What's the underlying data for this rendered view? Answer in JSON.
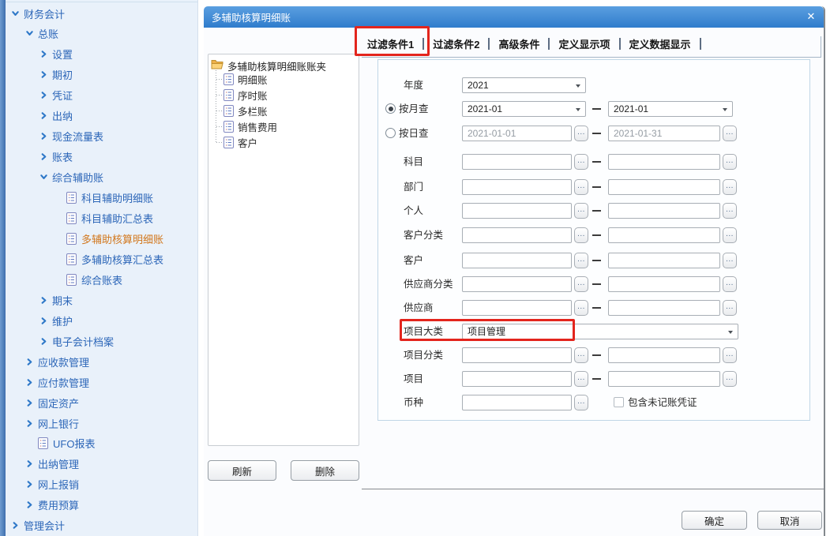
{
  "colors": {
    "titlebar_top": "#5b9fe0",
    "titlebar_bottom": "#2f7ccc",
    "sidebar_text": "#2c66b8",
    "sidebar_selected": "#d2771c",
    "annotation_red": "#e3251d",
    "chevron_blue": "#2e78c8",
    "folder_gold": "#f6c25a"
  },
  "icons": {
    "close": "✕",
    "browse_dots": "...",
    "chevron_expanded": "chevron-down",
    "chevron_collapsed": "chevron-right",
    "report": "report-document",
    "folder": "folder-open",
    "document": "document-page"
  },
  "sidebar": {
    "items": [
      {
        "label": "财务会计",
        "level": 0,
        "icon": "expanded"
      },
      {
        "label": "总账",
        "level": 1,
        "icon": "expanded"
      },
      {
        "label": "设置",
        "level": 2,
        "icon": "collapsed"
      },
      {
        "label": "期初",
        "level": 2,
        "icon": "collapsed"
      },
      {
        "label": "凭证",
        "level": 2,
        "icon": "collapsed"
      },
      {
        "label": "出纳",
        "level": 2,
        "icon": "collapsed"
      },
      {
        "label": "现金流量表",
        "level": 2,
        "icon": "collapsed"
      },
      {
        "label": "账表",
        "level": 2,
        "icon": "collapsed"
      },
      {
        "label": "综合辅助账",
        "level": 2,
        "icon": "expanded"
      },
      {
        "label": "科目辅助明细账",
        "level": 3,
        "icon": "doc"
      },
      {
        "label": "科目辅助汇总表",
        "level": 3,
        "icon": "doc"
      },
      {
        "label": "多辅助核算明细账",
        "level": 3,
        "icon": "doc",
        "selected": true
      },
      {
        "label": "多辅助核算汇总表",
        "level": 3,
        "icon": "doc"
      },
      {
        "label": "综合账表",
        "level": 3,
        "icon": "doc"
      },
      {
        "label": "期末",
        "level": 2,
        "icon": "collapsed"
      },
      {
        "label": "维护",
        "level": 2,
        "icon": "collapsed"
      },
      {
        "label": "电子会计档案",
        "level": 2,
        "icon": "collapsed"
      },
      {
        "label": "应收款管理",
        "level": 1,
        "icon": "collapsed"
      },
      {
        "label": "应付款管理",
        "level": 1,
        "icon": "collapsed"
      },
      {
        "label": "固定资产",
        "level": 1,
        "icon": "collapsed"
      },
      {
        "label": "网上银行",
        "level": 1,
        "icon": "collapsed"
      },
      {
        "label": "UFO报表",
        "level": 1,
        "icon": "doc"
      },
      {
        "label": "出纳管理",
        "level": 1,
        "icon": "collapsed"
      },
      {
        "label": "网上报销",
        "level": 1,
        "icon": "collapsed"
      },
      {
        "label": "费用预算",
        "level": 1,
        "icon": "collapsed"
      },
      {
        "label": "管理会计",
        "level": 0,
        "icon": "collapsed"
      }
    ]
  },
  "dialog": {
    "title": "多辅助核算明细账",
    "close_label": "✕",
    "tabs": [
      {
        "label": "过滤条件1",
        "active": true,
        "annotated": true
      },
      {
        "label": "过滤条件2",
        "active": false
      },
      {
        "label": "高级条件",
        "active": false
      },
      {
        "label": "定义显示项",
        "active": false
      },
      {
        "label": "定义数据显示",
        "active": false
      }
    ],
    "tree": {
      "root": "多辅助核算明细账账夹",
      "children": [
        "明细账",
        "序时账",
        "多栏账",
        "销售费用",
        "客户"
      ]
    },
    "form": {
      "year": {
        "label": "年度",
        "value": "2021"
      },
      "by_month": {
        "label": "按月查",
        "selected": true,
        "from": "2021-01",
        "to": "2021-01"
      },
      "by_day": {
        "label": "按日查",
        "selected": false,
        "from": "2021-01-01",
        "to": "2021-01-31"
      },
      "ranges": [
        "科目",
        "部门",
        "个人",
        "客户分类",
        "客户",
        "供应商分类",
        "供应商"
      ],
      "project_class": {
        "label": "项目大类",
        "value": "项目管理",
        "annotated": true
      },
      "ranges2": [
        "项目分类",
        "项目"
      ],
      "currency_label": "币种",
      "include_unposted_label": "包含未记账凭证",
      "include_unposted_checked": false,
      "browse_dots": "...",
      "range_dash": "—"
    },
    "buttons": {
      "refresh": "刷新",
      "delete": "删除",
      "ok": "确定",
      "cancel": "取消"
    }
  }
}
